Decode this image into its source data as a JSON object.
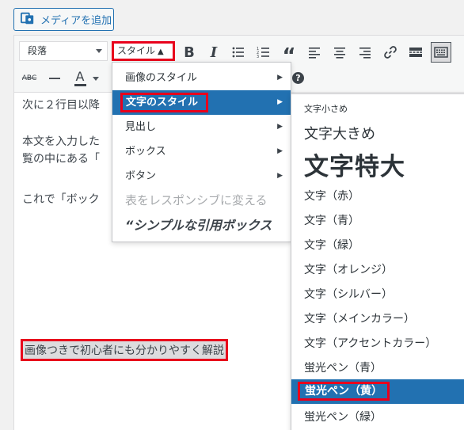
{
  "media_button": {
    "label": "メディアを追加",
    "icon": "media-icon"
  },
  "toolbar": {
    "format_select": "段落",
    "style_button": "スタイル",
    "row1_icons": [
      "bold-icon",
      "italic-icon",
      "bullet-list-icon",
      "numbered-list-icon",
      "blockquote-icon",
      "align-left-icon",
      "align-center-icon",
      "align-right-icon",
      "link-icon",
      "more-icon",
      "toolbar-toggle-icon"
    ],
    "row2_icons": [
      "strikethrough-icon",
      "horizontal-line-icon",
      "text-color-icon",
      "help-icon"
    ],
    "bold_glyph": "B",
    "italic_glyph": "I",
    "quote_glyph": "“",
    "strike_glyph": "ABC",
    "color_glyph": "A",
    "help_glyph": "?"
  },
  "content": {
    "line1": "次に２行目以降",
    "line2": "本文を入力した",
    "line3": "覧の中にある「",
    "line4": "これで「ボック",
    "highlight": "画像つきで初心者にも分かりやすく解説"
  },
  "menu1": {
    "items": [
      {
        "label": "画像のスタイル",
        "has_submenu": true
      },
      {
        "label": "文字のスタイル",
        "has_submenu": true,
        "selected": true
      },
      {
        "label": "見出し",
        "has_submenu": true
      },
      {
        "label": "ボックス",
        "has_submenu": true
      },
      {
        "label": "ボタン",
        "has_submenu": true
      },
      {
        "label": "表をレスポンシブに変える",
        "disabled": true
      },
      {
        "label": "“シンプルな引用ボックス"
      }
    ]
  },
  "menu2": {
    "items": [
      {
        "label": "文字小さめ",
        "size": "small"
      },
      {
        "label": "文字大きめ",
        "size": "large"
      },
      {
        "label": "文字特大",
        "size": "xlarge"
      },
      {
        "label": "文字（赤）",
        "size": "normal"
      },
      {
        "label": "文字（青）",
        "size": "normal"
      },
      {
        "label": "文字（緑）",
        "size": "normal"
      },
      {
        "label": "文字（オレンジ）",
        "size": "normal"
      },
      {
        "label": "文字（シルバー）",
        "size": "normal"
      },
      {
        "label": "文字（メインカラー）",
        "size": "normal"
      },
      {
        "label": "文字（アクセントカラー）",
        "size": "normal"
      },
      {
        "label": "蛍光ペン（青）",
        "size": "normal"
      },
      {
        "label": "蛍光ペン（黄）",
        "size": "normal",
        "selected": true
      },
      {
        "label": "蛍光ペン（緑）",
        "size": "normal"
      }
    ]
  },
  "colors": {
    "accent": "#2271b1",
    "highlight_box": "#e8001c",
    "text_color_underline": "#3c434a"
  }
}
